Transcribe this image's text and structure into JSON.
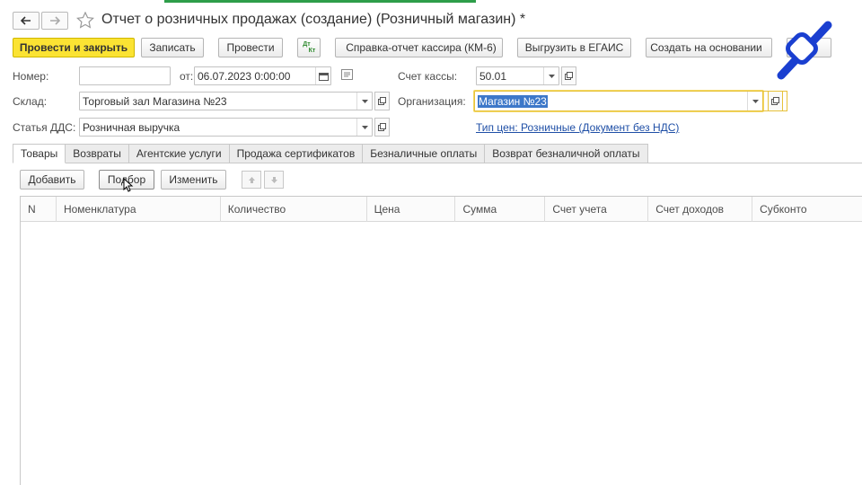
{
  "window": {
    "title": "Отчет о розничных продажах (создание) (Розничный магазин) *"
  },
  "nav": {
    "back_icon": "arrow-left-icon",
    "forward_icon": "arrow-right-icon",
    "favorite_icon": "star-icon"
  },
  "toolbar": {
    "post_close": "Провести и закрыть",
    "save": "Записать",
    "post": "Провести",
    "dt_kt_top": "Дт",
    "dt_kt_bottom": "Кт",
    "cashier_report": "Справка-отчет кассира (КМ-6)",
    "egais": "Выгрузить в ЕГАИС",
    "create_based": "Создать на основании"
  },
  "form": {
    "number_label": "Номер:",
    "number_value": "",
    "date_label": "от:",
    "date_value": "06.07.2023  0:00:00",
    "cash_account_label": "Счет кассы:",
    "cash_account_value": "50.01",
    "warehouse_label": "Склад:",
    "warehouse_value": "Торговый зал Магазина №23",
    "organization_label": "Организация:",
    "organization_value": "Магазин №23",
    "dds_label": "Статья ДДС:",
    "dds_value": "Розничная выручка",
    "price_type_link": "Тип цен: Розничные (Документ без НДС)"
  },
  "tabs": [
    {
      "label": "Товары",
      "active": true
    },
    {
      "label": "Возвраты",
      "active": false
    },
    {
      "label": "Агентские услуги",
      "active": false
    },
    {
      "label": "Продажа сертификатов",
      "active": false
    },
    {
      "label": "Безналичные оплаты",
      "active": false
    },
    {
      "label": "Возврат безналичной оплаты",
      "active": false
    }
  ],
  "table_toolbar": {
    "add": "Добавить",
    "pick": "Подбор",
    "change": "Изменить"
  },
  "table": {
    "columns": [
      "N",
      "Номенклатура",
      "Количество",
      "Цена",
      "Сумма",
      "Счет учета",
      "Счет доходов",
      "Субконто"
    ],
    "rows": []
  },
  "colors": {
    "primary_button": "#fbe333",
    "link": "#1f4fa6",
    "selection": "#3d78c9",
    "focus_border": "#e7c23a",
    "watermark": "#1a3fd0"
  }
}
